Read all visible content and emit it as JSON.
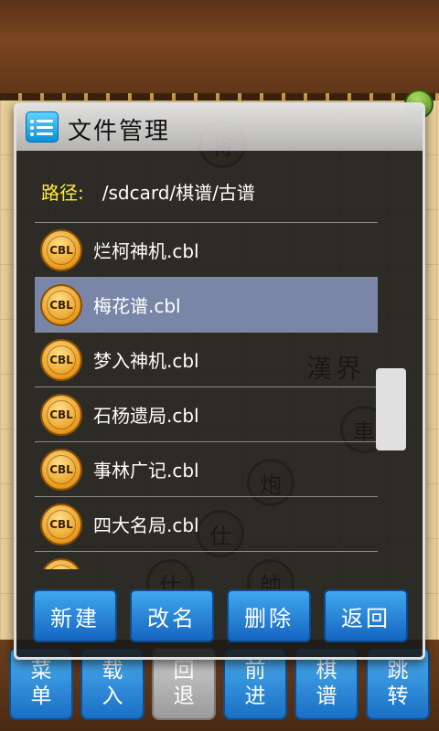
{
  "background": {
    "pieces": [
      {
        "name": "piece-general",
        "char": "将",
        "red": false
      },
      {
        "name": "piece-cannon",
        "char": "炮",
        "red": false
      },
      {
        "name": "piece-advisor-left",
        "char": "仕",
        "red": true
      },
      {
        "name": "piece-chariot",
        "char": "車",
        "red": false
      },
      {
        "name": "piece-advisor-bottom",
        "char": "仕",
        "red": true
      },
      {
        "name": "piece-marshal",
        "char": "帥",
        "red": true
      }
    ],
    "river_text": "漢界"
  },
  "toolbar": {
    "buttons": [
      {
        "line1": "菜",
        "line2": "单",
        "disabled": false
      },
      {
        "line1": "载",
        "line2": "入",
        "disabled": false
      },
      {
        "line1": "回",
        "line2": "退",
        "disabled": true
      },
      {
        "line1": "前",
        "line2": "进",
        "disabled": false
      },
      {
        "line1": "棋",
        "line2": "谱",
        "disabled": false
      },
      {
        "line1": "跳",
        "line2": "转",
        "disabled": false
      }
    ]
  },
  "dialog": {
    "title": "文件管理",
    "path_label": "路径:",
    "path_value": "/sdcard/棋谱/古谱",
    "icon_label": "CBL",
    "files": [
      {
        "name": "烂柯神机.cbl",
        "selected": false
      },
      {
        "name": "梅花谱.cbl",
        "selected": true
      },
      {
        "name": "梦入神机.cbl",
        "selected": false
      },
      {
        "name": "石杨遗局.cbl",
        "selected": false
      },
      {
        "name": "事林广记.cbl",
        "selected": false
      },
      {
        "name": "四大名局.cbl",
        "selected": false
      },
      {
        "name": "",
        "selected": false
      }
    ],
    "buttons": {
      "new": "新建",
      "rename": "改名",
      "delete": "删除",
      "back": "返回"
    }
  },
  "colors": {
    "path_label": "#ffeb3b",
    "selected_row": "#7a86a8",
    "button_blue": "#1565c0"
  }
}
